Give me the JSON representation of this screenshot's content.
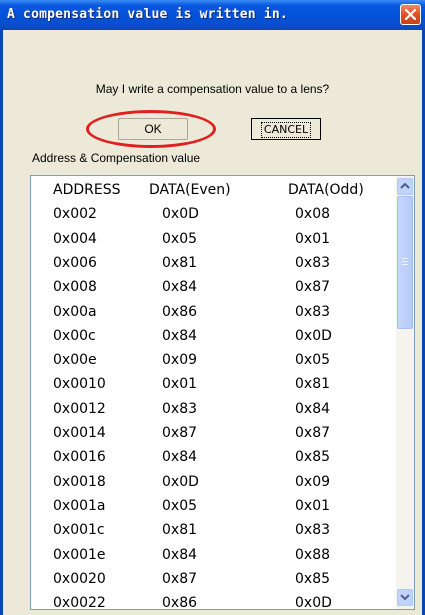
{
  "window": {
    "title": "A compensation value is written in."
  },
  "dialog": {
    "question": "May I write a compensation value to a lens?",
    "ok_label": "OK",
    "cancel_label": "CANCEL",
    "list_label": "Address & Compensation value"
  },
  "table": {
    "columns": [
      "ADDRESS",
      "DATA(Even)",
      "DATA(Odd)"
    ],
    "rows": [
      [
        "0x002",
        "0x0D",
        "0x08"
      ],
      [
        "0x004",
        "0x05",
        "0x01"
      ],
      [
        "0x006",
        "0x81",
        "0x83"
      ],
      [
        "0x008",
        "0x84",
        "0x87"
      ],
      [
        "0x00a",
        "0x86",
        "0x83"
      ],
      [
        "0x00c",
        "0x84",
        "0x0D"
      ],
      [
        "0x00e",
        "0x09",
        "0x05"
      ],
      [
        "0x0010",
        "0x01",
        "0x81"
      ],
      [
        "0x0012",
        "0x83",
        "0x84"
      ],
      [
        "0x0014",
        "0x87",
        "0x87"
      ],
      [
        "0x0016",
        "0x84",
        "0x85"
      ],
      [
        "0x0018",
        "0x0D",
        "0x09"
      ],
      [
        "0x001a",
        "0x05",
        "0x01"
      ],
      [
        "0x001c",
        "0x81",
        "0x83"
      ],
      [
        "0x001e",
        "0x84",
        "0x88"
      ],
      [
        "0x0020",
        "0x87",
        "0x85"
      ],
      [
        "0x0022",
        "0x86",
        "0x0D"
      ]
    ]
  },
  "colors": {
    "title_bar": "#0352d8",
    "close_button": "#e0542c",
    "annotation_circle": "#e02020",
    "dialog_background": "#ece9d8"
  },
  "icons": {
    "close": "close-icon",
    "scroll_up": "arrow-up-icon",
    "scroll_down": "arrow-down-icon"
  }
}
